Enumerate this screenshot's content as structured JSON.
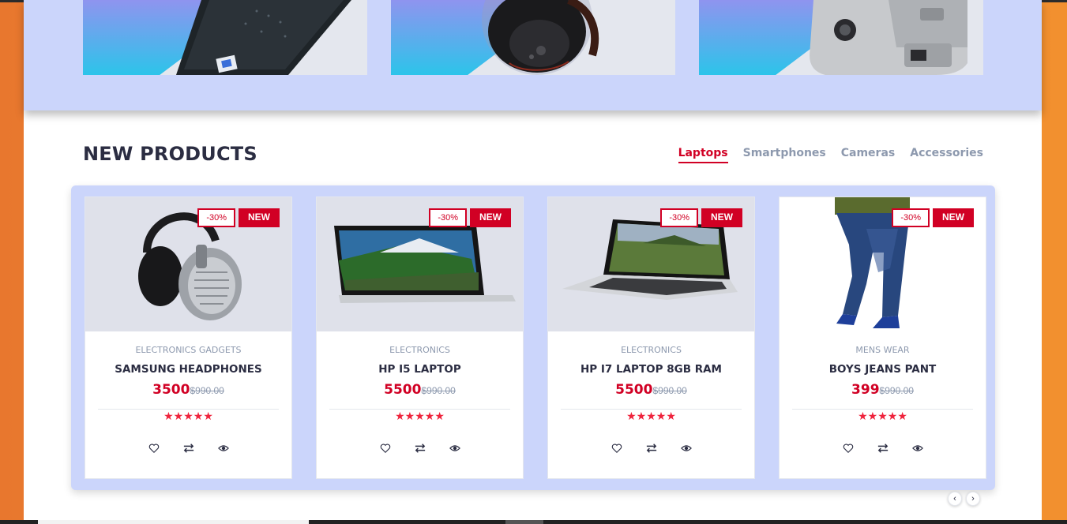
{
  "section": {
    "title": "NEW PRODUCTS",
    "tabs": [
      "Laptops",
      "Smartphones",
      "Cameras",
      "Accessories"
    ],
    "active_tab": "Laptops"
  },
  "collections": [
    {
      "image": "laptop-collection-image"
    },
    {
      "image": "headphones-collection-image"
    },
    {
      "image": "camera-collection-image"
    }
  ],
  "products": [
    {
      "category": "ELECTRONICS GADGETS",
      "name": "SAMSUNG HEADPHONES",
      "price": "3500",
      "old_price": "$990.00",
      "discount": "-30%",
      "badge": "NEW",
      "rating_stars": "★★★★★",
      "rating": 5
    },
    {
      "category": "ELECTRONICS",
      "name": "HP I5 LAPTOP",
      "price": "5500",
      "old_price": "$990.00",
      "discount": "-30%",
      "badge": "NEW",
      "rating_stars": "★★★★★",
      "rating": 5
    },
    {
      "category": "ELECTRONICS",
      "name": "HP I7 LAPTOP 8GB RAM",
      "price": "5500",
      "old_price": "$990.00",
      "discount": "-30%",
      "badge": "NEW",
      "rating_stars": "★★★★★",
      "rating": 5
    },
    {
      "category": "MENS WEAR",
      "name": "BOYS JEANS PANT",
      "price": "399",
      "old_price": "$990.00",
      "discount": "-30%",
      "badge": "NEW",
      "rating_stars": "★★★★★",
      "rating": 5
    }
  ],
  "icons": {
    "wishlist": "heart-icon",
    "compare": "exchange-icon",
    "quick_view": "eye-icon",
    "prev": "chevron-left-icon",
    "next": "chevron-right-icon"
  },
  "colors": {
    "accent": "#d10024",
    "panel": "#cbd5fb",
    "heading": "#2b2d42",
    "muted": "#8d99ae",
    "outer_background": "#f08a33"
  }
}
